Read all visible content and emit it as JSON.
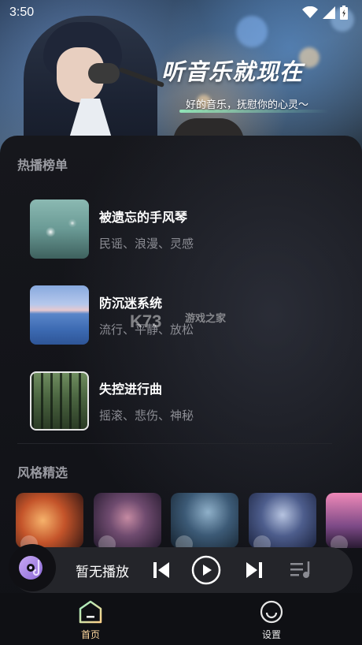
{
  "status_bar": {
    "time": "3:50"
  },
  "hero": {
    "title": "听音乐就现在",
    "subtitle": "好的音乐，抚慰你的心灵～"
  },
  "hot_list": {
    "title": "热播榜单",
    "songs": [
      {
        "name": "被遗忘的手风琴",
        "tags": "民谣、浪漫、灵感"
      },
      {
        "name": "防沉迷系统",
        "tags": "流行、平静、放松"
      },
      {
        "name": "失控进行曲",
        "tags": "摇滚、悲伤、神秘"
      }
    ]
  },
  "styles": {
    "title": "风格精选"
  },
  "player": {
    "now_playing": "暂无播放"
  },
  "nav": {
    "home_label": "首页",
    "settings_label": "设置"
  },
  "watermark": {
    "brand": "K73",
    "sub": "游戏之家"
  },
  "colors": {
    "accent": "#ffd9a0",
    "background": "#101116",
    "player_bg": "#24252a"
  }
}
